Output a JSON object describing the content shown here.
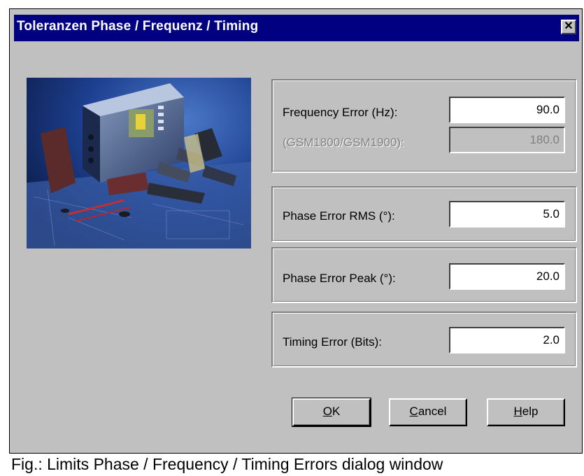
{
  "dialog": {
    "title": "Toleranzen Phase / Frequenz / Timing",
    "close_label": "✕"
  },
  "fields": {
    "frequency_error": {
      "label": "Frequency Error (Hz):",
      "value": "90.0"
    },
    "frequency_error_dcs": {
      "label": "(GSM1800/GSM1900):",
      "value": "180.0"
    },
    "phase_error_rms": {
      "label": "Phase Error RMS (°):",
      "value": "5.0"
    },
    "phase_error_peak": {
      "label": "Phase Error Peak (°):",
      "value": "20.0"
    },
    "timing_error": {
      "label": "Timing Error (Bits):",
      "value": "2.0"
    }
  },
  "buttons": {
    "ok": {
      "mnemonic": "O",
      "rest": "K"
    },
    "cancel": {
      "mnemonic": "C",
      "rest": "ancel"
    },
    "help": {
      "mnemonic": "H",
      "rest": "elp"
    }
  },
  "caption": "Fig.: Limits  Phase / Frequency / Timing Errors dialog window"
}
